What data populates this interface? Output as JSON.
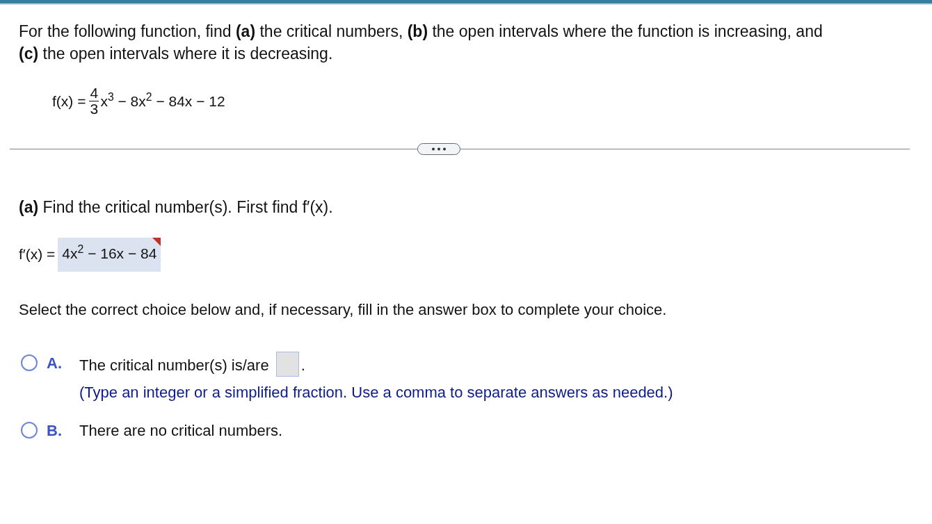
{
  "intro": "For the following function, find **(a)** the critical numbers, **(b)** the open intervals where the function is increasing, and **(c)** the open intervals where it is decreasing.",
  "function": {
    "lhs": "f(x) =",
    "numerator": "4",
    "denominator": "3",
    "rest": "x$^{3}$ − 8x$^{2}$ − 84x − 12"
  },
  "part_a": {
    "prompt": "**(a)** Find the critical number(s). First find f′(x).",
    "derivative_label": "f′(x) =",
    "derivative_answer": "4x$^{2}$ − 16x − 84",
    "flagged": true
  },
  "instruction": "Select the correct choice below and, if necessary, fill in the answer box to complete your choice.",
  "choices": [
    {
      "kind": "answer",
      "letter": "A.",
      "text": "The critical number(s) is/are",
      "after": ".",
      "hint": "(Type an integer or a simplified fraction. Use a comma to separate answers as needed.)",
      "selected": false
    },
    {
      "kind": "plain",
      "letter": "B.",
      "text": "There are no critical numbers.",
      "selected": false
    }
  ]
}
